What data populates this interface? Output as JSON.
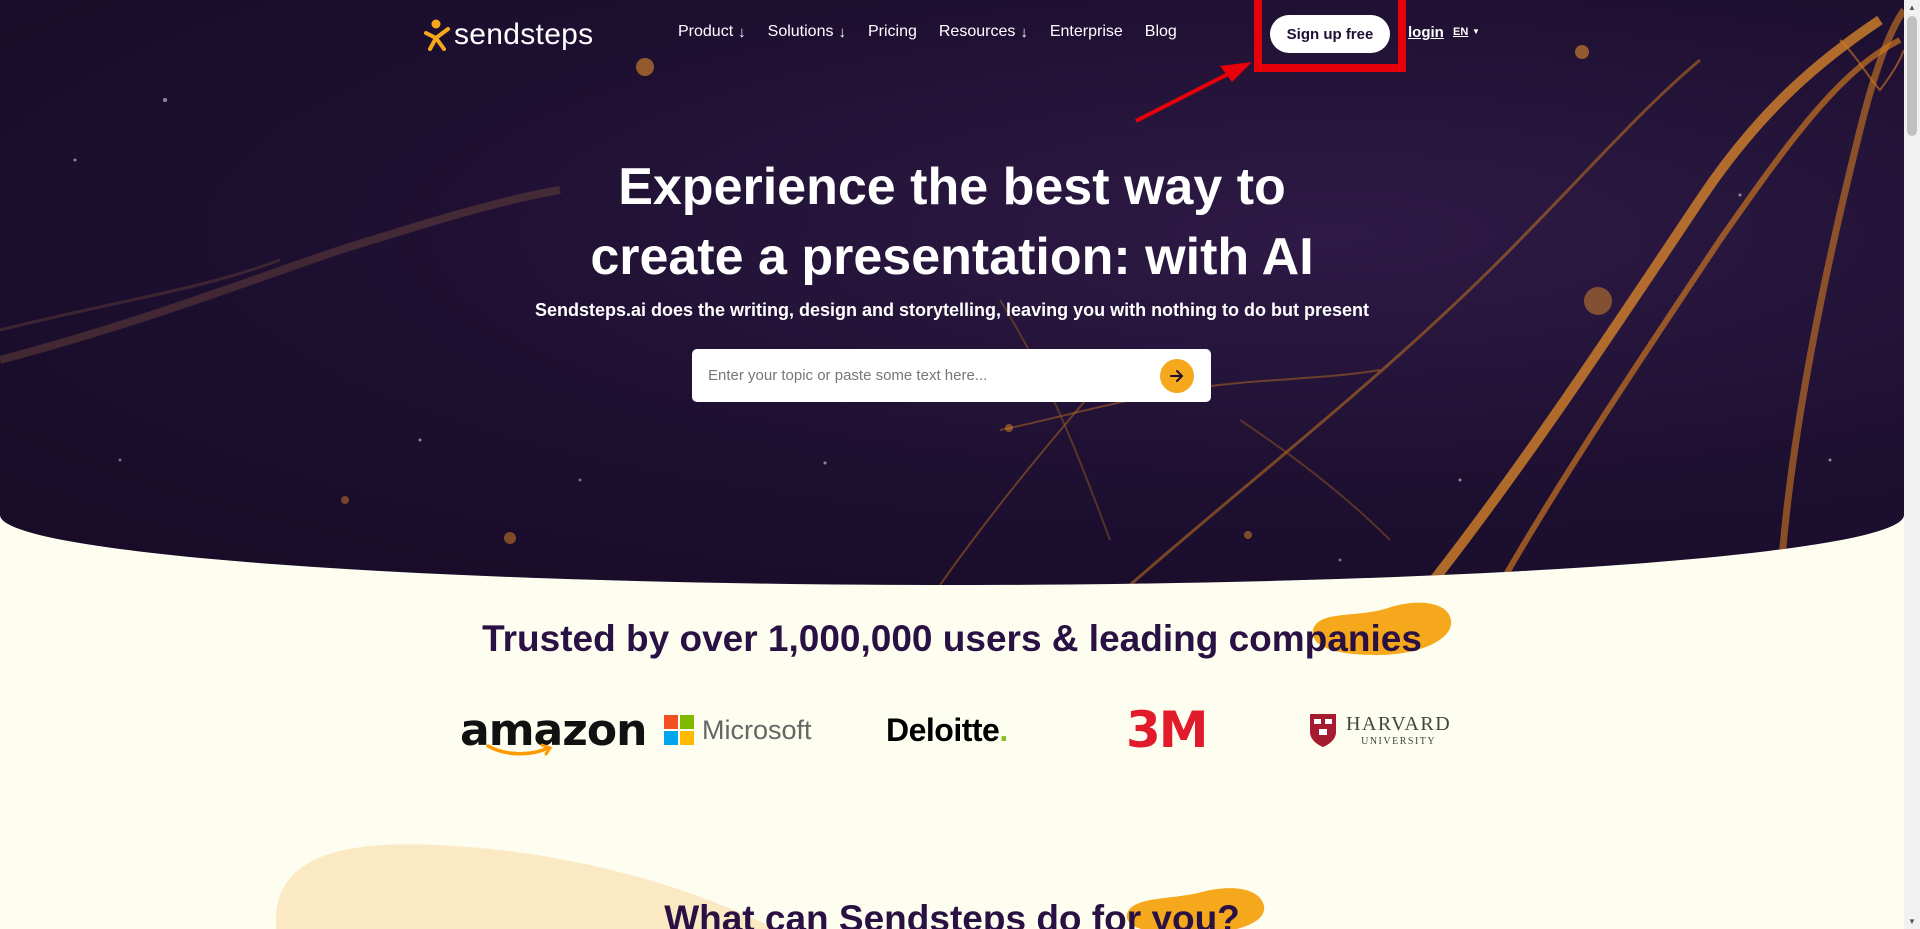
{
  "brand": {
    "name": "sendsteps"
  },
  "nav": {
    "items": [
      {
        "label": "Product",
        "has_dropdown": true
      },
      {
        "label": "Solutions",
        "has_dropdown": true
      },
      {
        "label": "Pricing",
        "has_dropdown": false
      },
      {
        "label": "Resources",
        "has_dropdown": true
      },
      {
        "label": "Enterprise",
        "has_dropdown": false
      },
      {
        "label": "Blog",
        "has_dropdown": false
      }
    ],
    "dropdown_arrow": "↓",
    "signup_label": "Sign up free",
    "login_label": "login",
    "language": "EN"
  },
  "hero": {
    "title_line1": "Experience the best way to",
    "title_line2": "create a presentation: with AI",
    "subtitle": "Sendsteps.ai does the writing, design and storytelling, leaving you with nothing to do but present",
    "input_placeholder": "Enter your topic or paste some text here...",
    "input_value": ""
  },
  "trusted": {
    "heading": "Trusted by over 1,000,000 users & leading companies",
    "logos": [
      "amazon",
      "Microsoft",
      "Deloitte",
      "3M",
      "HARVARD",
      "UNIVERSITY"
    ]
  },
  "section2": {
    "heading": "What can Sendsteps do for you?"
  },
  "colors": {
    "accent": "#f5a81c",
    "hero_bg": "#1d0f30",
    "page_bg": "#fdfdf0",
    "heading": "#2a1143",
    "highlight": "#e8000b"
  },
  "icons": [
    "sendsteps-logo-icon",
    "arrow-down-icon",
    "arrow-right-icon",
    "caret-down-icon"
  ]
}
